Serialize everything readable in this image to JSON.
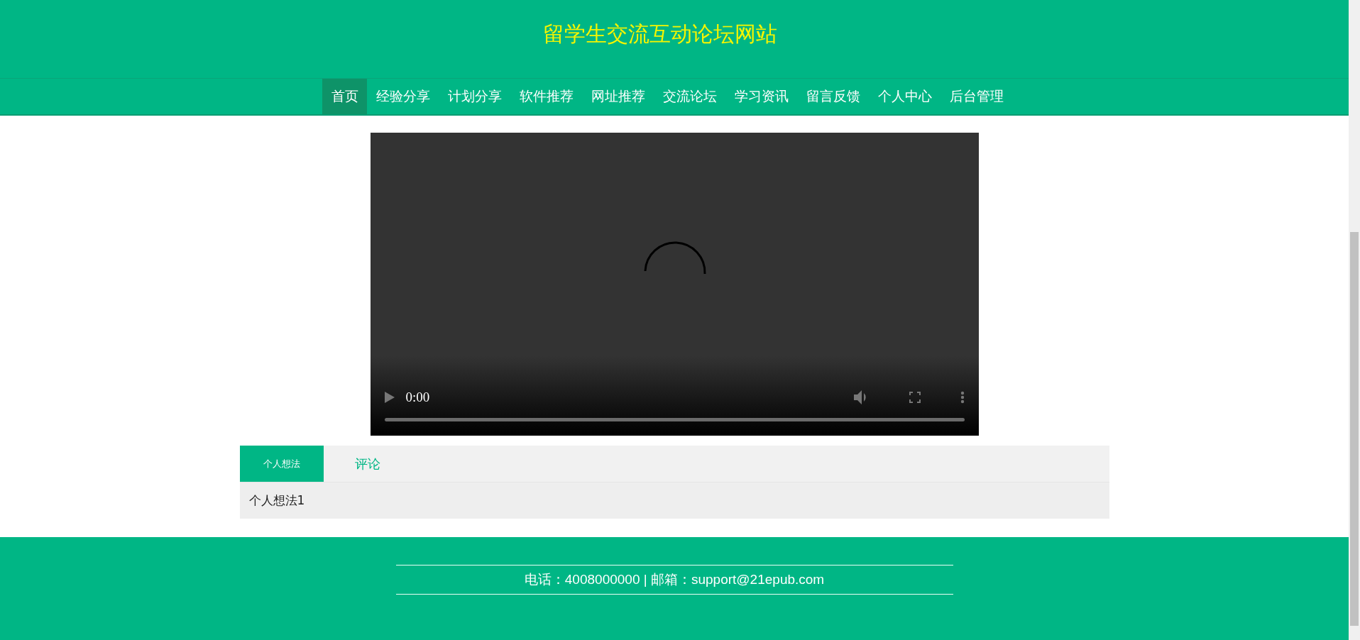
{
  "site_title": "留学生交流互动论坛网站",
  "nav": [
    {
      "label": "首页",
      "selected": true
    },
    {
      "label": "经验分享",
      "selected": false
    },
    {
      "label": "计划分享",
      "selected": false
    },
    {
      "label": "软件推荐",
      "selected": false
    },
    {
      "label": "网址推荐",
      "selected": false
    },
    {
      "label": "交流论坛",
      "selected": false
    },
    {
      "label": "学习资讯",
      "selected": false
    },
    {
      "label": "留言反馈",
      "selected": false
    },
    {
      "label": "个人中心",
      "selected": false
    },
    {
      "label": "后台管理",
      "selected": false
    }
  ],
  "video": {
    "time": "0:00",
    "level": 0
  },
  "tabs": [
    {
      "label": "个人想法",
      "selected": true
    },
    {
      "label": "评论",
      "selected": false
    }
  ],
  "tab_content": "个人想法1",
  "footer": {
    "contact": "电话：4008000000 | 邮箱：support@21epub.com"
  }
}
